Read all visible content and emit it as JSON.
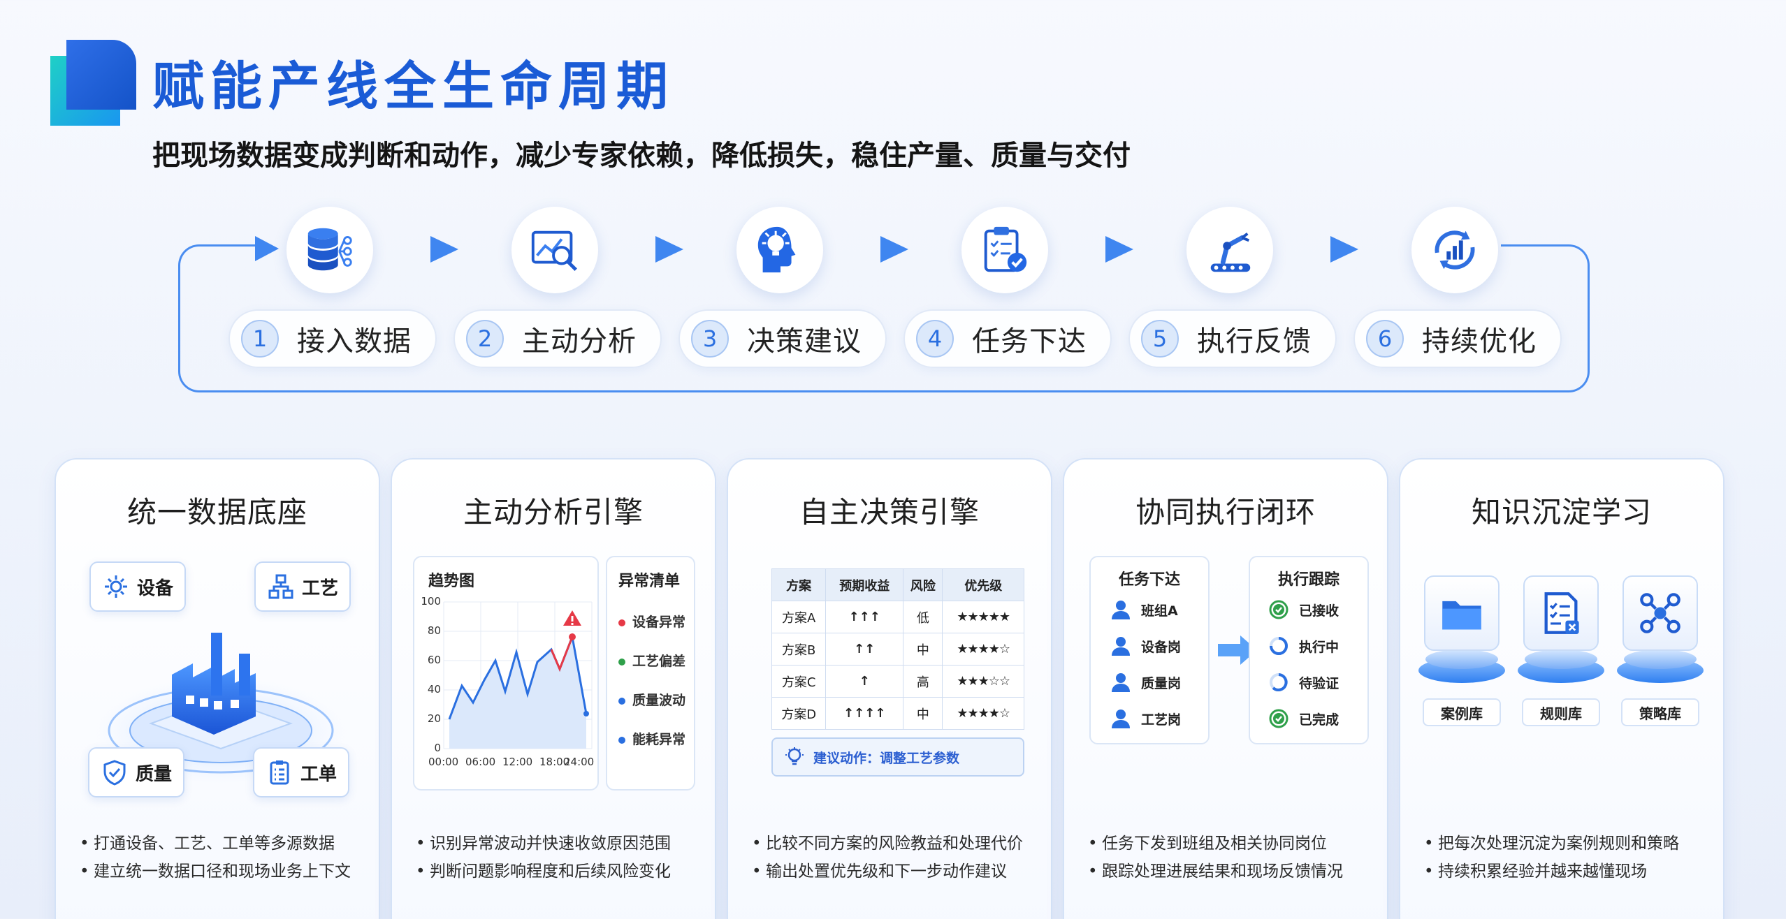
{
  "header": {
    "title": "赋能产线全生命周期",
    "subtitle": "把现场数据变成判断和动作，减少专家依赖，降低损失，稳住产量、质量与交付"
  },
  "colors": {
    "brand": "#1a5bd6",
    "accent": "#3f86f0",
    "success": "#2fa04a",
    "danger": "#e63946"
  },
  "flow": {
    "steps": [
      {
        "num": "1",
        "label": "接入数据",
        "icon": "database-icon"
      },
      {
        "num": "2",
        "label": "主动分析",
        "icon": "chart-search-icon"
      },
      {
        "num": "3",
        "label": "决策建议",
        "icon": "head-lightbulb-icon"
      },
      {
        "num": "4",
        "label": "任务下达",
        "icon": "clipboard-check-icon"
      },
      {
        "num": "5",
        "label": "执行反馈",
        "icon": "robot-arm-icon"
      },
      {
        "num": "6",
        "label": "持续优化",
        "icon": "refresh-chart-icon"
      }
    ]
  },
  "cards": {
    "data": {
      "title": "统一数据底座",
      "chips": {
        "device": "设备",
        "process": "工艺",
        "quality": "质量",
        "order": "工单"
      },
      "bullets": [
        "打通设备、工艺、工单等多源数据",
        "建立统一数据口径和现场业务上下文"
      ]
    },
    "analysis": {
      "title": "主动分析引擎",
      "trend_title": "趋势图",
      "y_ticks": [
        "100",
        "80",
        "60",
        "40",
        "20",
        "0"
      ],
      "x_ticks": [
        "00:00",
        "06:00",
        "12:00",
        "18:00",
        "24:00"
      ],
      "anomaly_title": "异常清单",
      "anomalies": [
        "设备异常",
        "工艺偏差",
        "质量波动",
        "能耗异常"
      ],
      "bullets": [
        "识别异常波动并快速收敛原因范围",
        "判断问题影响程度和后续风险变化"
      ]
    },
    "decision": {
      "title": "自主决策引擎",
      "headers": [
        "方案",
        "预期收益",
        "风险",
        "优先级"
      ],
      "rows": [
        [
          "方案A",
          "↑↑↑",
          "低",
          "★★★★★"
        ],
        [
          "方案B",
          "↑↑",
          "中",
          "★★★★☆"
        ],
        [
          "方案C",
          "↑",
          "高",
          "★★★☆☆"
        ],
        [
          "方案D",
          "↑↑↑↑",
          "中",
          "★★★★☆"
        ]
      ],
      "advice": "建议动作：调整工艺参数",
      "bullets": [
        "比较不同方案的风险教益和处理代价",
        "输出处置优先级和下一步动作建议"
      ]
    },
    "execution": {
      "title": "协同执行闭环",
      "dispatch_title": "任务下达",
      "roles": [
        "班组A",
        "设备岗",
        "质量岗",
        "工艺岗"
      ],
      "track_title": "执行跟踪",
      "statuses": [
        "已接收",
        "执行中",
        "待验证",
        "已完成"
      ],
      "bullets": [
        "任务下发到班组及相关协同岗位",
        "跟踪处理进展结果和现场反馈情况"
      ]
    },
    "knowledge": {
      "title": "知识沉淀学习",
      "libraries": [
        "案例库",
        "规则库",
        "策略库"
      ],
      "bullets": [
        "把每次处理沉淀为案例规则和策略",
        "持续积累经验并越来越懂现场"
      ]
    }
  }
}
